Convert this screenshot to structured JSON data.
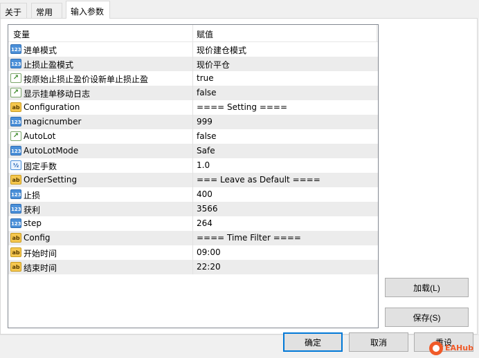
{
  "tabs": [
    {
      "label": "关于",
      "active": false
    },
    {
      "label": "常用",
      "active": false
    },
    {
      "label": "输入参数",
      "active": true
    }
  ],
  "table": {
    "col_variable": "变量",
    "col_value": "赋值",
    "rows": [
      {
        "type": "int",
        "icon": "int-type-icon",
        "name": "进单模式",
        "value": "现价建仓模式"
      },
      {
        "type": "int",
        "icon": "int-type-icon",
        "name": "止损止盈模式",
        "value": "现价平仓"
      },
      {
        "type": "bool",
        "icon": "bool-type-icon",
        "name": "按原始止损止盈价设新单止损止盈",
        "value": "true"
      },
      {
        "type": "bool",
        "icon": "bool-type-icon",
        "name": "显示挂单移动日志",
        "value": "false"
      },
      {
        "type": "str",
        "icon": "string-type-icon",
        "name": "Configuration",
        "value": "==== Setting ===="
      },
      {
        "type": "int",
        "icon": "int-type-icon",
        "name": "magicnumber",
        "value": "999"
      },
      {
        "type": "bool",
        "icon": "bool-type-icon",
        "name": "AutoLot",
        "value": "false"
      },
      {
        "type": "int",
        "icon": "int-type-icon",
        "name": "AutoLotMode",
        "value": "Safe"
      },
      {
        "type": "dbl",
        "icon": "double-type-icon",
        "name": "固定手数",
        "value": "1.0"
      },
      {
        "type": "str",
        "icon": "string-type-icon",
        "name": "OrderSetting",
        "value": "=== Leave as Default ===="
      },
      {
        "type": "int",
        "icon": "int-type-icon",
        "name": "止损",
        "value": "400"
      },
      {
        "type": "int",
        "icon": "int-type-icon",
        "name": "获利",
        "value": "3566"
      },
      {
        "type": "int",
        "icon": "int-type-icon",
        "name": "step",
        "value": "264"
      },
      {
        "type": "str",
        "icon": "string-type-icon",
        "name": "Config",
        "value": "==== Time Filter ===="
      },
      {
        "type": "str",
        "icon": "string-type-icon",
        "name": "开始时间",
        "value": "09:00"
      },
      {
        "type": "str",
        "icon": "string-type-icon",
        "name": "结束时间",
        "value": "22:20"
      }
    ]
  },
  "side_buttons": {
    "load": "加载(L)",
    "save": "保存(S)"
  },
  "footer_buttons": {
    "ok": "确定",
    "cancel": "取消",
    "reset": "重设"
  },
  "icon_glyphs": {
    "int": "123",
    "bool": "↗",
    "str": "ab",
    "dbl": "½"
  },
  "watermark": "EAHub"
}
